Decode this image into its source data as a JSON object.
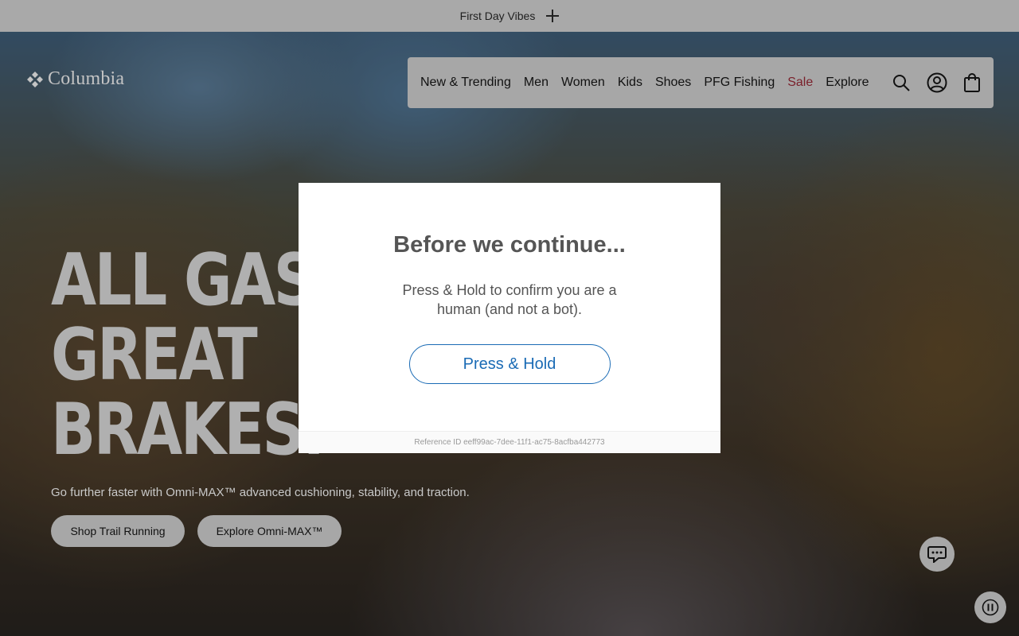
{
  "promo": {
    "text": "First Day Vibes",
    "expand_icon": "plus-icon"
  },
  "brand": {
    "logo_text": "Columbia",
    "logo_icon": "columbia-diamond-icon"
  },
  "nav": {
    "items": [
      {
        "label": "New & Trending"
      },
      {
        "label": "Men"
      },
      {
        "label": "Women"
      },
      {
        "label": "Kids"
      },
      {
        "label": "Shoes"
      },
      {
        "label": "PFG Fishing"
      },
      {
        "label": "Sale",
        "color": "#7a1f2a"
      },
      {
        "label": "Explore"
      }
    ],
    "icons": [
      "search-icon",
      "account-icon",
      "cart-icon"
    ]
  },
  "hero": {
    "headline": [
      "ALL GAS,",
      "GREAT",
      "BRAKES."
    ],
    "subtitle": "Go further faster with Omni-MAX™ advanced cushioning, stability, and traction.",
    "buttons": [
      {
        "label": "Shop Trail Running"
      },
      {
        "label": "Explore Omni-MAX™"
      }
    ]
  },
  "modal": {
    "title": "Before we continue...",
    "message": "Press & Hold to confirm you are a human (and not a bot).",
    "button_label": "Press & Hold",
    "reference": "Reference ID eeff99ac-7dee-11f1-ac75-8acfba442773",
    "accent_color": "#1a6bb5"
  },
  "floating": {
    "chat_icon": "chat-icon",
    "pause_icon": "pause-icon"
  }
}
